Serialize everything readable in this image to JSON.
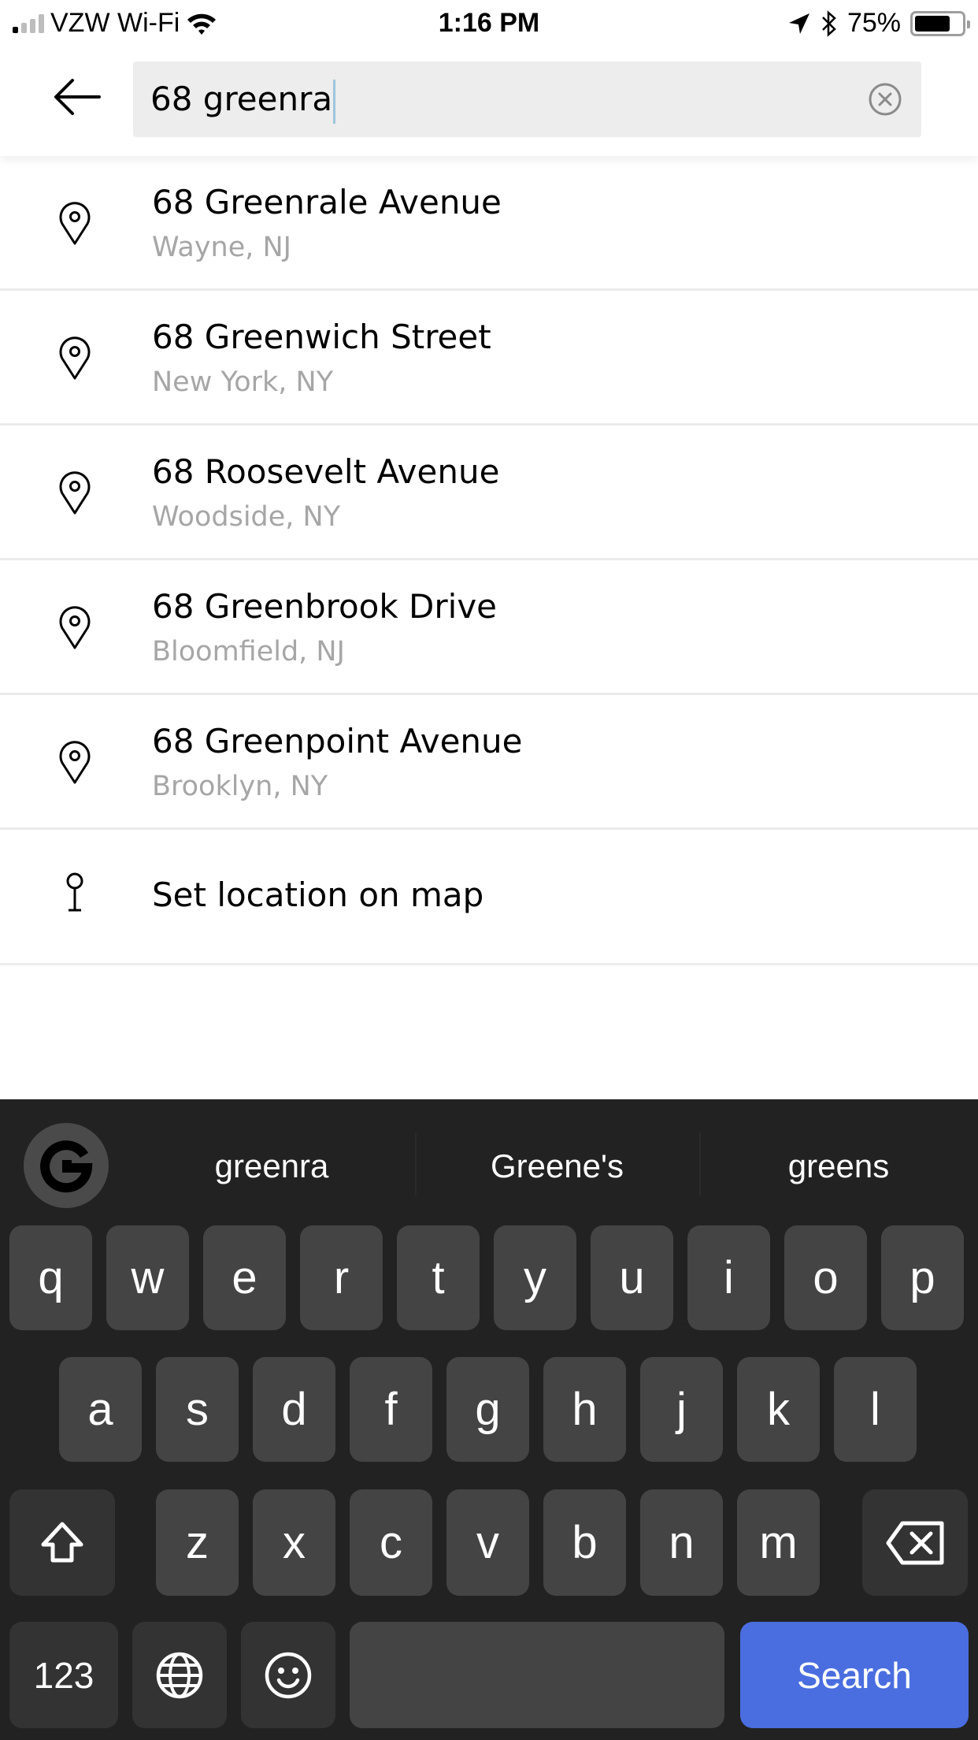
{
  "status_bar": {
    "carrier": "VZW Wi-Fi",
    "time": "1:16 PM",
    "battery_percent": "75%",
    "battery_level": 0.75,
    "signal_bars": 1,
    "icons": [
      "signal-icon",
      "wifi-icon",
      "location-arrow-icon",
      "bluetooth-icon",
      "battery-icon"
    ]
  },
  "header": {
    "back_icon": "arrow-left-icon",
    "search_value": "68 greenra",
    "clear_icon": "clear-circle-x-icon"
  },
  "results": [
    {
      "title": "68 Greenrale Avenue",
      "subtitle": "Wayne, NJ",
      "icon": "map-pin-icon"
    },
    {
      "title": "68 Greenwich Street",
      "subtitle": "New York, NY",
      "icon": "map-pin-icon"
    },
    {
      "title": "68 Roosevelt Avenue",
      "subtitle": "Woodside, NY",
      "icon": "map-pin-icon"
    },
    {
      "title": "68 Greenbrook Drive",
      "subtitle": "Bloomfield, NJ",
      "icon": "map-pin-icon"
    },
    {
      "title": "68 Greenpoint Avenue",
      "subtitle": "Brooklyn, NY",
      "icon": "map-pin-icon"
    }
  ],
  "set_location": {
    "label": "Set location on map",
    "icon": "pin-on-map-icon"
  },
  "keyboard": {
    "google_button": "G",
    "suggestions": [
      "greenra",
      "Greene's",
      "greens"
    ],
    "row1": [
      "q",
      "w",
      "e",
      "r",
      "t",
      "y",
      "u",
      "i",
      "o",
      "p"
    ],
    "row2": [
      "a",
      "s",
      "d",
      "f",
      "g",
      "h",
      "j",
      "k",
      "l"
    ],
    "row3": [
      "z",
      "x",
      "c",
      "v",
      "b",
      "n",
      "m"
    ],
    "shift_icon": "shift-icon",
    "backspace_icon": "backspace-icon",
    "numbers_label": "123",
    "globe_icon": "globe-icon",
    "emoji_icon": "emoji-icon",
    "search_label": "Search",
    "accent_color": "#4a6ee0"
  }
}
